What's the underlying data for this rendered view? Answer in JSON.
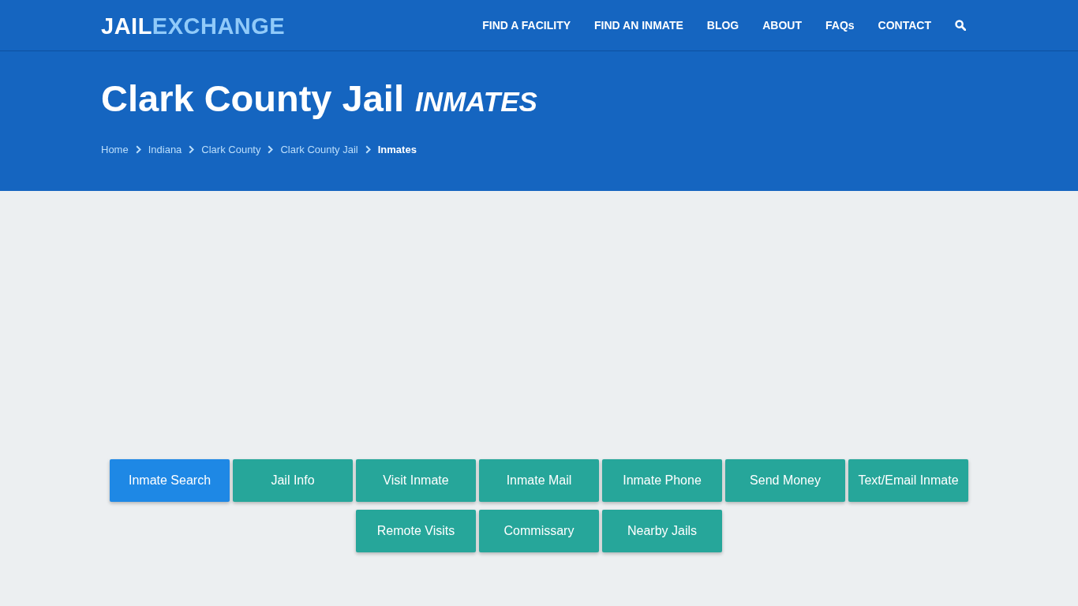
{
  "logo": {
    "part1": "JAIL",
    "part2": "EXCHANGE"
  },
  "nav": {
    "items": [
      "FIND A FACILITY",
      "FIND AN INMATE",
      "BLOG",
      "ABOUT",
      "FAQs",
      "CONTACT"
    ]
  },
  "hero": {
    "title": "Clark County Jail",
    "subtitle": "INMATES",
    "breadcrumbs": [
      {
        "label": "Home",
        "current": false
      },
      {
        "label": "Indiana",
        "current": false
      },
      {
        "label": "Clark County",
        "current": false
      },
      {
        "label": "Clark County Jail",
        "current": false
      },
      {
        "label": "Inmates",
        "current": true
      }
    ]
  },
  "actions": [
    {
      "label": "Inmate Search",
      "selected": true
    },
    {
      "label": "Jail Info",
      "selected": false
    },
    {
      "label": "Visit Inmate",
      "selected": false
    },
    {
      "label": "Inmate Mail",
      "selected": false
    },
    {
      "label": "Inmate Phone",
      "selected": false
    },
    {
      "label": "Send Money",
      "selected": false
    },
    {
      "label": "Text/Email Inmate",
      "selected": false
    },
    {
      "label": "Remote Visits",
      "selected": false
    },
    {
      "label": "Commissary",
      "selected": false
    },
    {
      "label": "Nearby Jails",
      "selected": false
    }
  ]
}
